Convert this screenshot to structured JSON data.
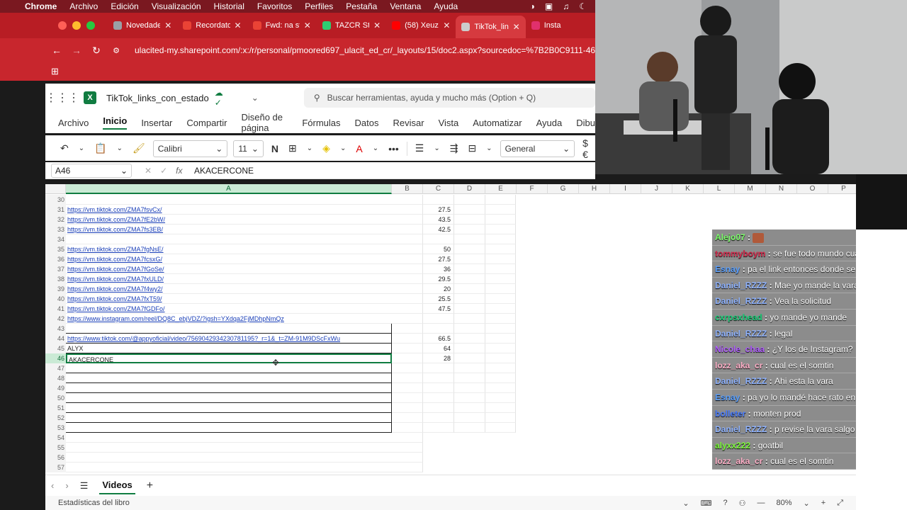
{
  "menubar": {
    "items": [
      "Chrome",
      "Archivo",
      "Edición",
      "Visualización",
      "Historial",
      "Favoritos",
      "Perfiles",
      "Pestaña",
      "Ventana",
      "Ayuda"
    ]
  },
  "tabs": [
    {
      "label": "Novedades",
      "color": "#9aa0a6"
    },
    {
      "label": "Recordator",
      "color": "#ea4335"
    },
    {
      "label": "Fwd: na ste",
      "color": "#ea4335"
    },
    {
      "label": "TAZCR Stre",
      "color": "#2ecc71"
    },
    {
      "label": "(58) Xeuz -",
      "color": "#ff0000"
    },
    {
      "label": "TikTok_link",
      "color": "#cccccc"
    },
    {
      "label": "Insta",
      "color": "#e1306c"
    }
  ],
  "url": "ulacited-my.sharepoint.com/:x:/r/personal/pmoored697_ulacit_ed_cr/_layouts/15/doc2.aspx?sourcedoc=%7B2B0C9111-461",
  "excel": {
    "doc_title": "TikTok_links_con_estado",
    "search_placeholder": "Buscar herramientas, ayuda y mucho más (Option + Q)",
    "menu_tabs": [
      "Archivo",
      "Inicio",
      "Insertar",
      "Compartir",
      "Diseño de página",
      "Fórmulas",
      "Datos",
      "Revisar",
      "Vista",
      "Automatizar",
      "Ayuda",
      "Dibu"
    ],
    "font": "Calibri",
    "font_size": "11",
    "bold_label": "N",
    "number_format": "General",
    "currency": "$€",
    "namebox": "A46",
    "formula_value": "AKACERCONE",
    "fx_label": "fx"
  },
  "columns": [
    "A",
    "B",
    "C",
    "D",
    "E",
    "F",
    "G",
    "H",
    "I",
    "J",
    "K",
    "L",
    "M",
    "N",
    "O",
    "P"
  ],
  "rows": [
    {
      "n": "30",
      "a": "",
      "c": ""
    },
    {
      "n": "31",
      "a": "https://vm.tiktok.com/ZMA7fsvCx/",
      "c": "27.5",
      "link": true
    },
    {
      "n": "32",
      "a": "https://vm.tiktok.com/ZMA7fE2bW/",
      "c": "43.5",
      "link": true
    },
    {
      "n": "33",
      "a": "https://vm.tiktok.com/ZMA7fs3EB/",
      "c": "42.5",
      "link": true
    },
    {
      "n": "34",
      "a": "",
      "c": ""
    },
    {
      "n": "35",
      "a": "https://vm.tiktok.com/ZMA7fgNsE/",
      "c": "50",
      "link": true
    },
    {
      "n": "36",
      "a": "https://vm.tiktok.com/ZMA7fcsxG/",
      "c": "27.5",
      "link": true
    },
    {
      "n": "37",
      "a": "https://vm.tiktok.com/ZMA7fGoSe/",
      "c": "36",
      "link": true
    },
    {
      "n": "38",
      "a": "https://vm.tiktok.com/ZMA7fxULD/",
      "c": "29.5",
      "link": true
    },
    {
      "n": "39",
      "a": "https://vm.tiktok.com/ZMA7f4wy2/",
      "c": "20",
      "link": true
    },
    {
      "n": "40",
      "a": "https://vm.tiktok.com/ZMA7fxT59/",
      "c": "25.5",
      "link": true
    },
    {
      "n": "41",
      "a": "https://vm.tiktok.com/ZMA7fGDFo/",
      "c": "47.5",
      "link": true
    },
    {
      "n": "42",
      "a": "https://www.instagram.com/reel/DQ8C_ebjVDZ/?igsh=YXdqa2FjMDhpNmQz",
      "c": "",
      "link": true
    },
    {
      "n": "43",
      "a": "",
      "c": ""
    },
    {
      "n": "44",
      "a": "https://www.tiktok.com/@appyoficial/video/7569042934230781195?_r=1&_t=ZM-91M9DScFxWu",
      "c": "66.5",
      "link": true
    },
    {
      "n": "45",
      "a": "ALYX",
      "c": "64"
    },
    {
      "n": "46",
      "a": "AKACERCONE",
      "c": "28",
      "selected": true
    },
    {
      "n": "47",
      "a": "",
      "c": ""
    },
    {
      "n": "48",
      "a": "",
      "c": ""
    },
    {
      "n": "49",
      "a": "",
      "c": ""
    },
    {
      "n": "50",
      "a": "",
      "c": ""
    },
    {
      "n": "51",
      "a": "",
      "c": ""
    },
    {
      "n": "52",
      "a": "",
      "c": ""
    },
    {
      "n": "53",
      "a": "",
      "c": ""
    },
    {
      "n": "54",
      "a": "",
      "c": ""
    },
    {
      "n": "55",
      "a": "",
      "c": ""
    },
    {
      "n": "56",
      "a": "",
      "c": ""
    },
    {
      "n": "57",
      "a": "",
      "c": ""
    }
  ],
  "chat": [
    {
      "user": "Alejo07",
      "color": "#7cfc6a",
      "text": ""
    },
    {
      "user": "tommyboym",
      "color": "#d42a4c",
      "text": "se fue todo mundo cuando iba yo JA"
    },
    {
      "user": "Esnay",
      "color": "#5aa0ff",
      "text": "pa el link entonces donde se manda??, yo l"
    },
    {
      "user": "Daniel_RZZZ",
      "color": "#8fb3ff",
      "text": "Mae yo mande la vara"
    },
    {
      "user": "Daniel_RZZZ",
      "color": "#8fb3ff",
      "text": "Vea la solicitud"
    },
    {
      "user": "cxrpsxhead",
      "color": "#1ccf7a",
      "text": "yo mande yo mande"
    },
    {
      "user": "Daniel_RZZZ",
      "color": "#8fb3ff",
      "text": "legal"
    },
    {
      "user": "Nicole_chaa",
      "color": "#b05cff",
      "text": "¿Y los de Instagram?"
    },
    {
      "user": "lozz_aka_cr",
      "color": "#ffb0c8",
      "text": "cual es el somtin"
    },
    {
      "user": "Daniel_RZZZ",
      "color": "#8fb3ff",
      "text": "Ahi esta la vara"
    },
    {
      "user": "Esnay",
      "color": "#5aa0ff",
      "text": "pa yo lo mandé hace rato en insta, en pnati"
    },
    {
      "user": "bolleter",
      "color": "#4a7dff",
      "text": "monten prod"
    },
    {
      "user": "Daniel_RZZZ",
      "color": "#8fb3ff",
      "text": "p revise la vara salgo como godkid"
    },
    {
      "user": "alyxx222",
      "color": "#7cfc3a",
      "text": "goatbil"
    },
    {
      "user": "lozz_aka_cr",
      "color": "#ffb0c8",
      "text": "cual es el somtin"
    }
  ],
  "sheetbar": {
    "sheet_name": "Videos",
    "add": "+"
  },
  "statusbar": {
    "left": "Estadísticas del libro",
    "zoom": "80%"
  }
}
